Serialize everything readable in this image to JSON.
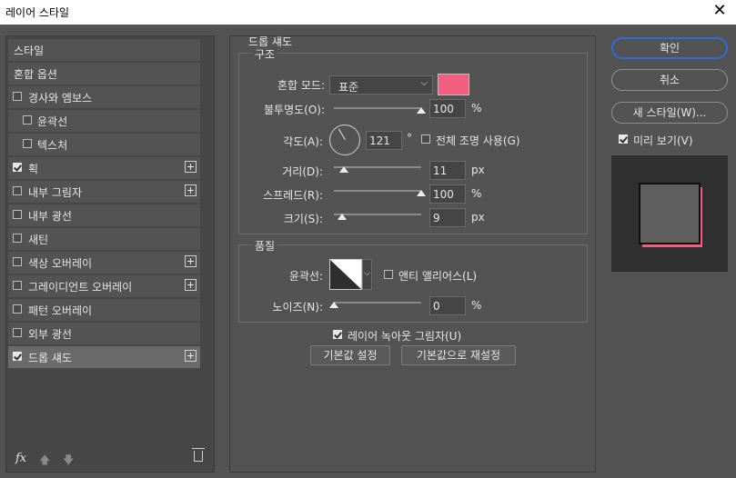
{
  "window": {
    "title": "레이어 스타일",
    "close_glyph": "✕"
  },
  "styles_panel": {
    "items": [
      {
        "label": "스타일",
        "checkbox": false,
        "checked": false,
        "plus": false,
        "indent": false,
        "selected": false
      },
      {
        "label": "혼합 옵션",
        "checkbox": false,
        "checked": false,
        "plus": false,
        "indent": false,
        "selected": false
      },
      {
        "label": "경사와 엠보스",
        "checkbox": true,
        "checked": false,
        "plus": false,
        "indent": false,
        "selected": false
      },
      {
        "label": "윤곽선",
        "checkbox": true,
        "checked": false,
        "plus": false,
        "indent": true,
        "selected": false
      },
      {
        "label": "텍스처",
        "checkbox": true,
        "checked": false,
        "plus": false,
        "indent": true,
        "selected": false
      },
      {
        "label": "획",
        "checkbox": true,
        "checked": true,
        "plus": true,
        "indent": false,
        "selected": false
      },
      {
        "label": "내부 그림자",
        "checkbox": true,
        "checked": false,
        "plus": true,
        "indent": false,
        "selected": false
      },
      {
        "label": "내부 광선",
        "checkbox": true,
        "checked": false,
        "plus": false,
        "indent": false,
        "selected": false
      },
      {
        "label": "새틴",
        "checkbox": true,
        "checked": false,
        "plus": false,
        "indent": false,
        "selected": false
      },
      {
        "label": "색상 오버레이",
        "checkbox": true,
        "checked": false,
        "plus": true,
        "indent": false,
        "selected": false
      },
      {
        "label": "그레이디언트 오버레이",
        "checkbox": true,
        "checked": false,
        "plus": true,
        "indent": false,
        "selected": false
      },
      {
        "label": "패턴 오버레이",
        "checkbox": true,
        "checked": false,
        "plus": false,
        "indent": false,
        "selected": false
      },
      {
        "label": "외부 광선",
        "checkbox": true,
        "checked": false,
        "plus": false,
        "indent": false,
        "selected": false
      },
      {
        "label": "드롭 섀도",
        "checkbox": true,
        "checked": true,
        "plus": true,
        "indent": false,
        "selected": true
      }
    ],
    "bottom_icons": [
      "fx-icon",
      "move-up-icon",
      "move-down-icon",
      "trash-icon"
    ],
    "fx_label": "fx"
  },
  "drop_shadow": {
    "heading": "드롭 섀도",
    "structure": {
      "legend": "구조",
      "blend_mode_label": "혼합 모드:",
      "blend_mode_value": "표준",
      "shadow_color": "#f25e80",
      "opacity_label": "불투명도(O):",
      "opacity_value": "100",
      "opacity_unit": "%",
      "opacity_level": 1.0,
      "angle_label": "각도(A):",
      "angle_value": "121",
      "angle_unit": "°",
      "global_light_label": "전체 조명 사용(G)",
      "global_light_checked": false,
      "distance_label": "거리(D):",
      "distance_value": "11",
      "distance_unit": "px",
      "distance_level": 0.11,
      "spread_label": "스프레드(R):",
      "spread_value": "100",
      "spread_unit": "%",
      "spread_level": 1.0,
      "size_label": "크기(S):",
      "size_value": "9",
      "size_unit": "px",
      "size_level": 0.09
    },
    "quality": {
      "legend": "품질",
      "contour_label": "윤곽선:",
      "antialias_label": "앤티 앨리어스(L)",
      "antialias_checked": false,
      "noise_label": "노이즈(N):",
      "noise_value": "0",
      "noise_unit": "%",
      "noise_level": 0.0
    },
    "knockout_label": "레이어 녹아웃 그림자(U)",
    "knockout_checked": true,
    "make_default_label": "기본값 설정",
    "reset_default_label": "기본값으로 재설정"
  },
  "actions": {
    "ok_label": "확인",
    "cancel_label": "취소",
    "new_style_label": "새 스타일(W)...",
    "preview_label": "미리 보기(V)",
    "preview_checked": true
  }
}
